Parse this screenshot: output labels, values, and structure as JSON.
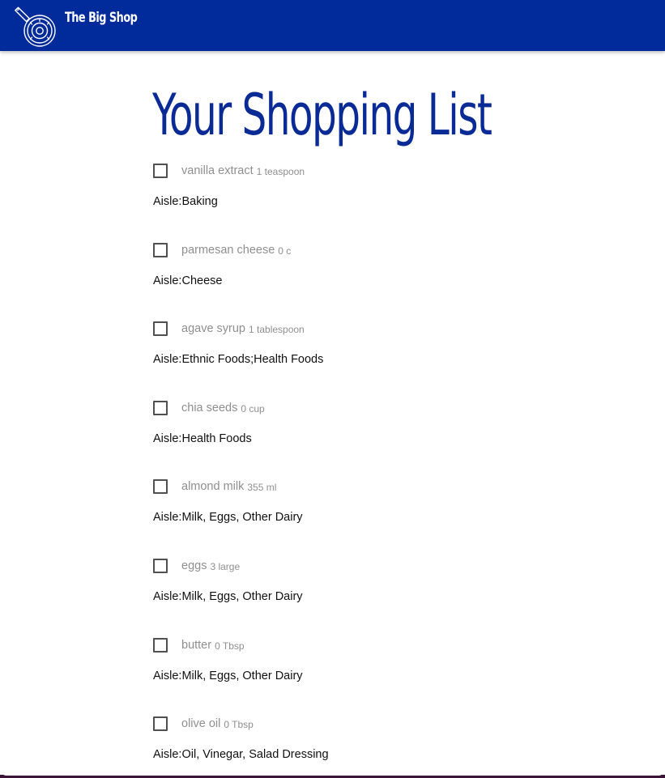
{
  "header": {
    "brand": "The Big Shop",
    "logo_icon": "frying-pan-icon",
    "background_color": "#012a9a"
  },
  "main": {
    "title": "Your Shopping List",
    "aisle_prefix": "Aisle:",
    "items": [
      {
        "name": "vanilla extract",
        "quantity": "1 teaspoon",
        "aisle": "Baking"
      },
      {
        "name": "parmesan cheese",
        "quantity": "0 c",
        "aisle": "Cheese"
      },
      {
        "name": "agave syrup",
        "quantity": "1 tablespoon",
        "aisle": "Ethnic Foods;Health Foods"
      },
      {
        "name": "chia seeds",
        "quantity": "0 cup",
        "aisle": "Health Foods"
      },
      {
        "name": "almond milk",
        "quantity": "355 ml",
        "aisle": "Milk, Eggs, Other Dairy"
      },
      {
        "name": "eggs",
        "quantity": "3 large",
        "aisle": "Milk, Eggs, Other Dairy"
      },
      {
        "name": "butter",
        "quantity": "0 Tbsp",
        "aisle": "Milk, Eggs, Other Dairy"
      },
      {
        "name": "olive oil",
        "quantity": "0 Tbsp",
        "aisle": "Oil, Vinegar, Salad Dressing"
      }
    ]
  }
}
